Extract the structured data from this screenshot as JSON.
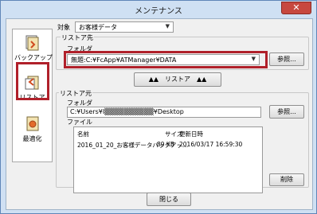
{
  "window": {
    "title": "メンテナンス"
  },
  "sidebar": {
    "items": [
      {
        "label": "バックアップ",
        "icon": "backup-icon"
      },
      {
        "label": "リストア",
        "icon": "restore-icon",
        "selected": true
      },
      {
        "label": "最適化",
        "icon": "optimize-icon"
      }
    ]
  },
  "target": {
    "label": "対象",
    "value": "お客様データ"
  },
  "restore_source": {
    "group_label": "リストア先",
    "folder_label": "フォルダ",
    "folder_value": "無題:C:¥FcApp¥ATManager¥DATA",
    "browse_label": "参照..."
  },
  "restore_button": {
    "label": "▲▲　リストア　▲▲"
  },
  "restore_origin": {
    "group_label": "リストア元",
    "folder_label": "フォルダ",
    "folder_value": "C:¥Users¥I▒▒▒▒▒▒▒▒▒▒¥Desktop",
    "browse_label": "参照...",
    "file_label": "ファイル",
    "columns": {
      "name": "名前",
      "size": "サイズ",
      "date": "更新日時"
    },
    "rows": [
      {
        "name": "2016_01_20_お客様データバックアッ...",
        "size": "89 KB",
        "date": "2016/03/17 16:59:30"
      }
    ],
    "delete_label": "削除"
  },
  "close_label": "閉じる",
  "colors": {
    "highlight": "#b0202a",
    "titlebar_close": "#c7483f"
  }
}
